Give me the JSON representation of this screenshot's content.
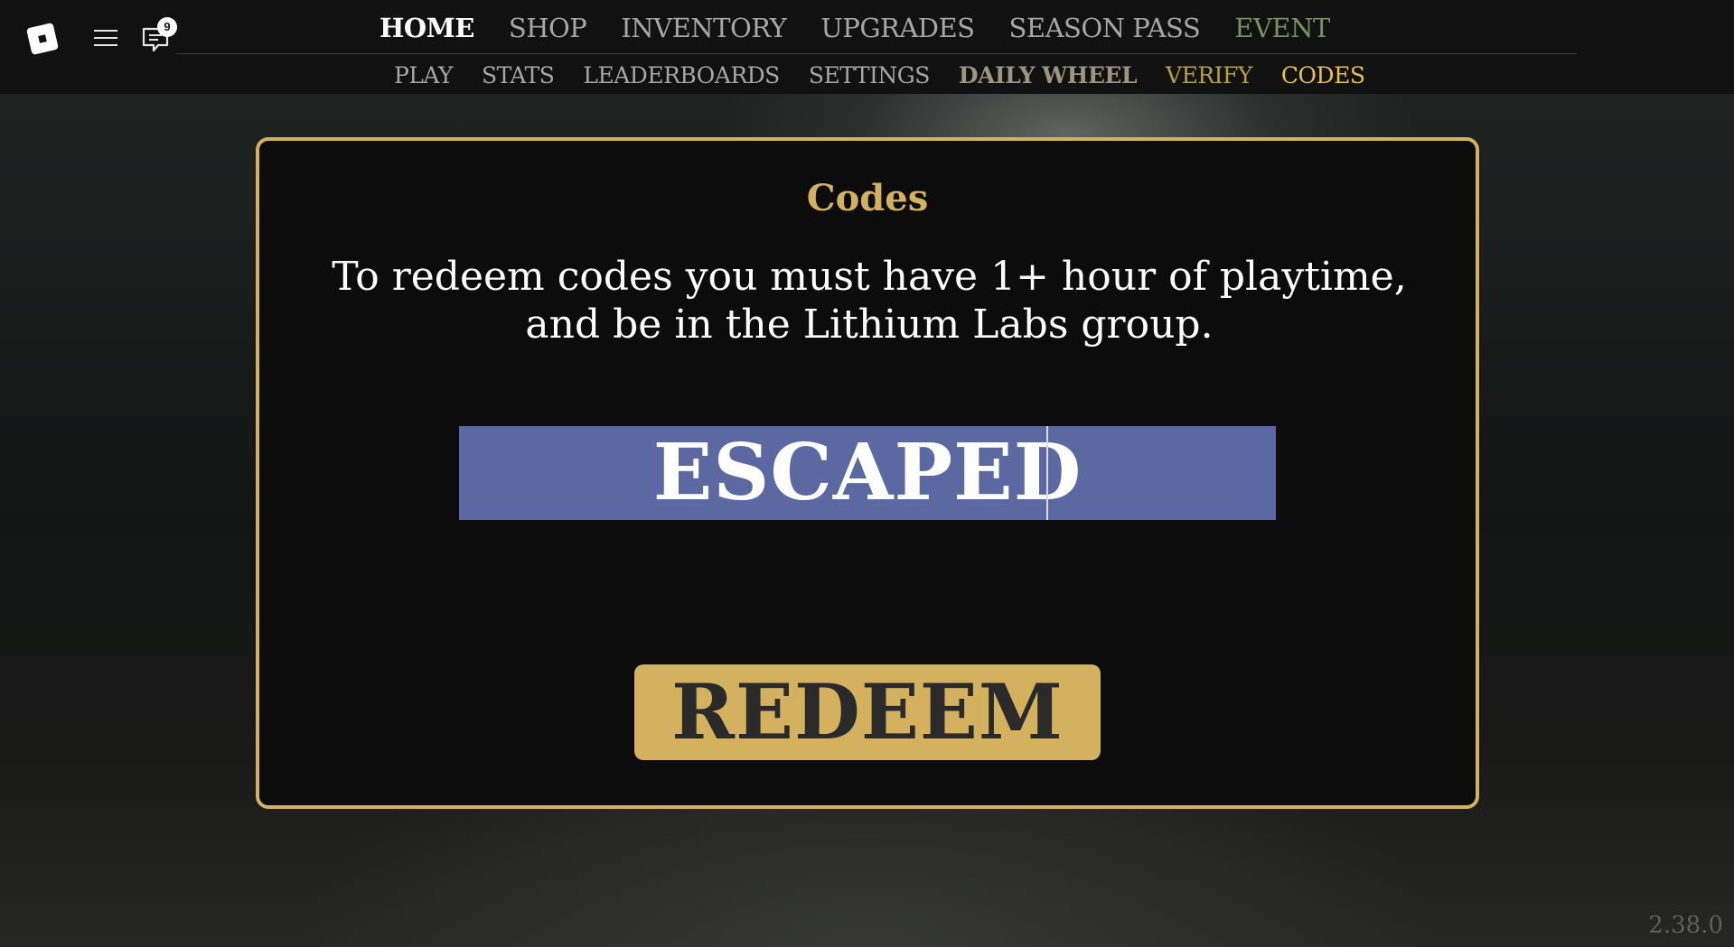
{
  "topbar": {
    "chat_badge_count": "9",
    "icons": {
      "logo": "roblox-logo-icon",
      "menu": "hamburger-menu-icon",
      "chat": "chat-icon"
    }
  },
  "nav_main": {
    "items": [
      "HOME",
      "SHOP",
      "INVENTORY",
      "UPGRADES",
      "SEASON PASS",
      "EVENT"
    ],
    "active": "HOME"
  },
  "nav_sub": {
    "items": [
      "PLAY",
      "STATS",
      "LEADERBOARDS",
      "SETTINGS",
      "DAILY WHEEL",
      "VERIFY",
      "CODES"
    ]
  },
  "codes_panel": {
    "title": "Codes",
    "description": "To redeem codes you must have 1+ hour of playtime, and be in the Lithium Labs group.",
    "input_value": "ESCAPED",
    "redeem_label": "REDEEM"
  },
  "version": "2.38.0",
  "colors": {
    "accent_gold": "#d3b15f",
    "input_bg": "#5b68a2",
    "event_green": "#7a8f63",
    "verify_yellow": "#b6a33c",
    "codes_yellow": "#e7c34c"
  }
}
